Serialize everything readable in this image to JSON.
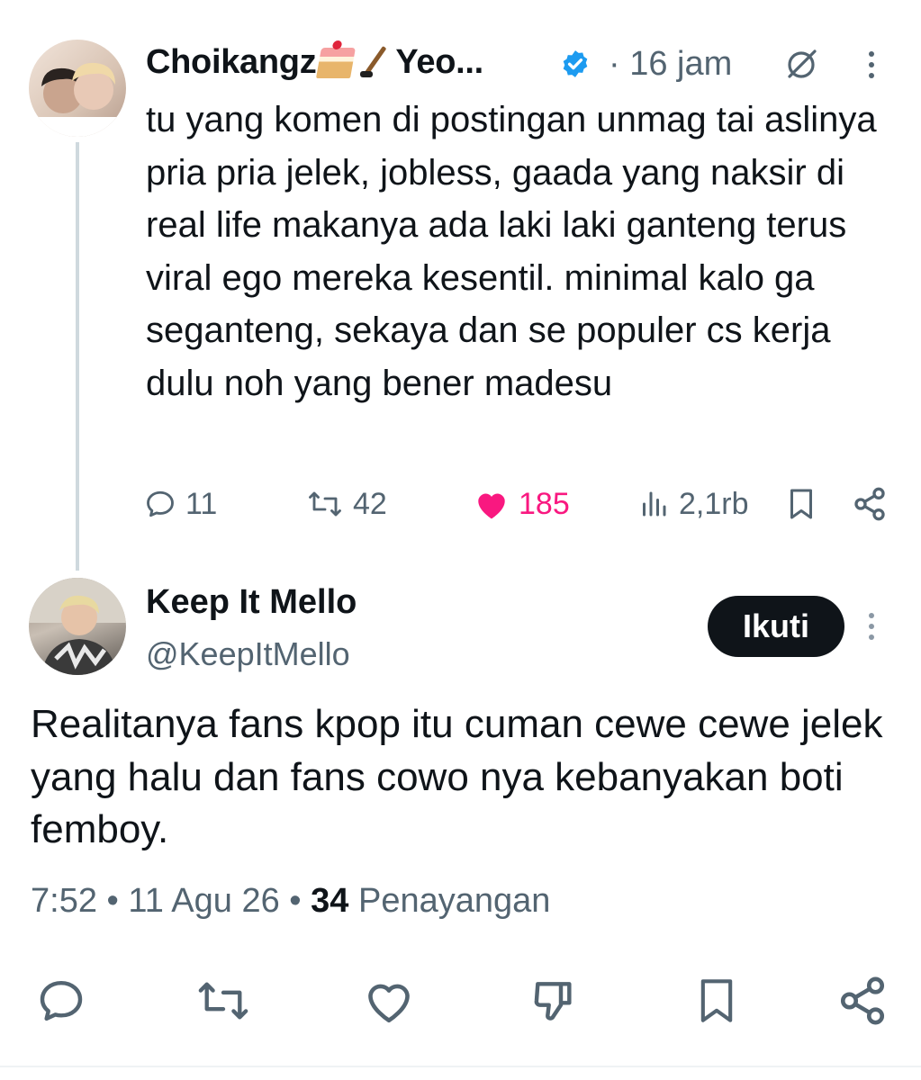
{
  "parent_tweet": {
    "author_name": "Choikangz",
    "author_name_suffix": "Yeo...",
    "timestamp": "· 16 jam",
    "text": "tu yang komen di postingan unmag tai aslinya pria pria jelek, jobless, gaada yang naksir di real life makanya ada laki laki ganteng terus viral ego mereka kesentil. minimal kalo ga seganteng, sekaya dan se populer cs kerja dulu noh yang bener madesu",
    "actions": {
      "replies": "11",
      "reposts": "42",
      "likes": "185",
      "views": "2,1rb"
    },
    "like_color": "#f91880",
    "verified_color": "#1d9bf0"
  },
  "reply_tweet": {
    "author_name": "Keep It Mello",
    "handle": "@KeepItMello",
    "follow_label": "Ikuti",
    "text": "Realitanya fans kpop itu cuman cewe cewe jelek yang halu dan fans cowo nya kebanyakan boti femboy.",
    "meta": {
      "time": "7:52 • 11 Agu 26 •",
      "views_count": "34",
      "views_label": "Penayangan"
    }
  },
  "icons": {
    "verified": "verified-badge-icon",
    "grok": "grok-icon",
    "more": "more-vertical-icon",
    "reply": "reply-icon",
    "repost": "repost-icon",
    "like": "heart-icon",
    "views": "views-icon",
    "bookmark": "bookmark-icon",
    "share": "share-icon",
    "dislike": "dislike-icon"
  }
}
